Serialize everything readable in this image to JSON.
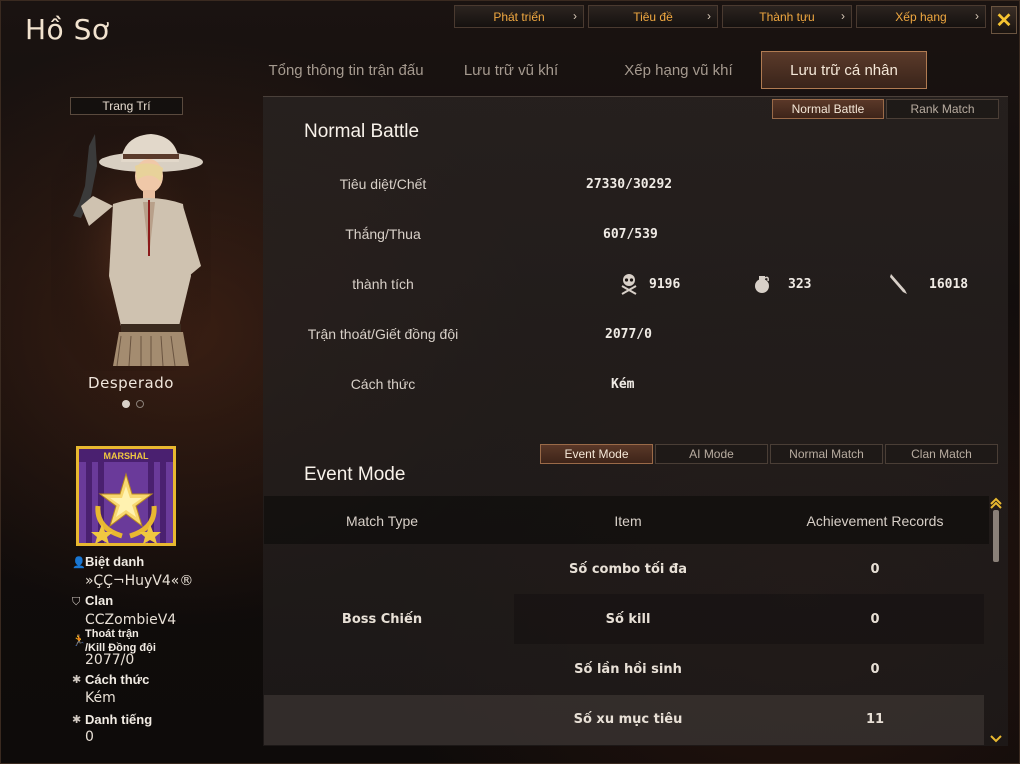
{
  "window": {
    "title": "Hồ Sơ",
    "close_icon": "close-icon"
  },
  "top_menu": [
    {
      "label": "Phát triển"
    },
    {
      "label": "Tiêu đề"
    },
    {
      "label": "Thành tựu"
    },
    {
      "label": "Xếp hạng"
    }
  ],
  "main_tabs": [
    {
      "label": "Tổng thông tin trận đấu",
      "active": false
    },
    {
      "label": "Lưu trữ vũ khí",
      "active": false
    },
    {
      "label": "Xếp hạng vũ khí",
      "active": false
    },
    {
      "label": "Lưu trữ cá nhân",
      "active": true
    }
  ],
  "left": {
    "decorate_button": "Trang Trí",
    "character_name": "Desperado",
    "rank_badge_text": "MARSHAL",
    "nickname_label": "Biệt danh",
    "nickname_value": "»ÇÇ¬HuyV4«®",
    "clan_label": "Clan",
    "clan_value": "CCZombieV4",
    "escape_label_1": "Thoát trận",
    "escape_label_2": "/Kill Đồng đội",
    "escape_value": "2077/0",
    "style_label": "Cách thức",
    "style_value": "Kém",
    "fame_label": "Danh tiếng",
    "fame_value": "0"
  },
  "battle_tabs": [
    {
      "label": "Normal Battle",
      "active": true
    },
    {
      "label": "Rank Match",
      "active": false
    }
  ],
  "normal_battle": {
    "title": "Normal Battle",
    "kill_death_label": "Tiêu diệt/Chết",
    "kill_death_value": "27330/30292",
    "win_loss_label": "Thắng/Thua",
    "win_loss_value": "607/539",
    "achievement_label": "thành tích",
    "achievement_skull": "9196",
    "achievement_grenade": "323",
    "achievement_knife": "16018",
    "escape_label": "Trận thoát/Giết đồng đội",
    "escape_value": "2077/0",
    "style_label": "Cách thức",
    "style_value": "Kém"
  },
  "mode_tabs": [
    {
      "label": "Event Mode",
      "active": true
    },
    {
      "label": "AI Mode",
      "active": false
    },
    {
      "label": "Normal Match",
      "active": false
    },
    {
      "label": "Clan Match",
      "active": false
    }
  ],
  "event_mode": {
    "title": "Event Mode",
    "columns": [
      "Match Type",
      "Item",
      "Achievement Records"
    ],
    "match_type": "Boss Chiến",
    "rows": [
      {
        "item": "Số combo tối đa",
        "record": "0"
      },
      {
        "item": "Số kill",
        "record": "0"
      },
      {
        "item": "Số lần hồi sinh",
        "record": "0"
      },
      {
        "item": "Số xu mục tiêu",
        "record": "11"
      }
    ]
  },
  "colors": {
    "accent_orange": "#f0a840",
    "active_tab_border": "#b07b52",
    "close_x": "#f6c431",
    "badge_purple": "#6a3a9a",
    "badge_gold": "#e8b830"
  }
}
